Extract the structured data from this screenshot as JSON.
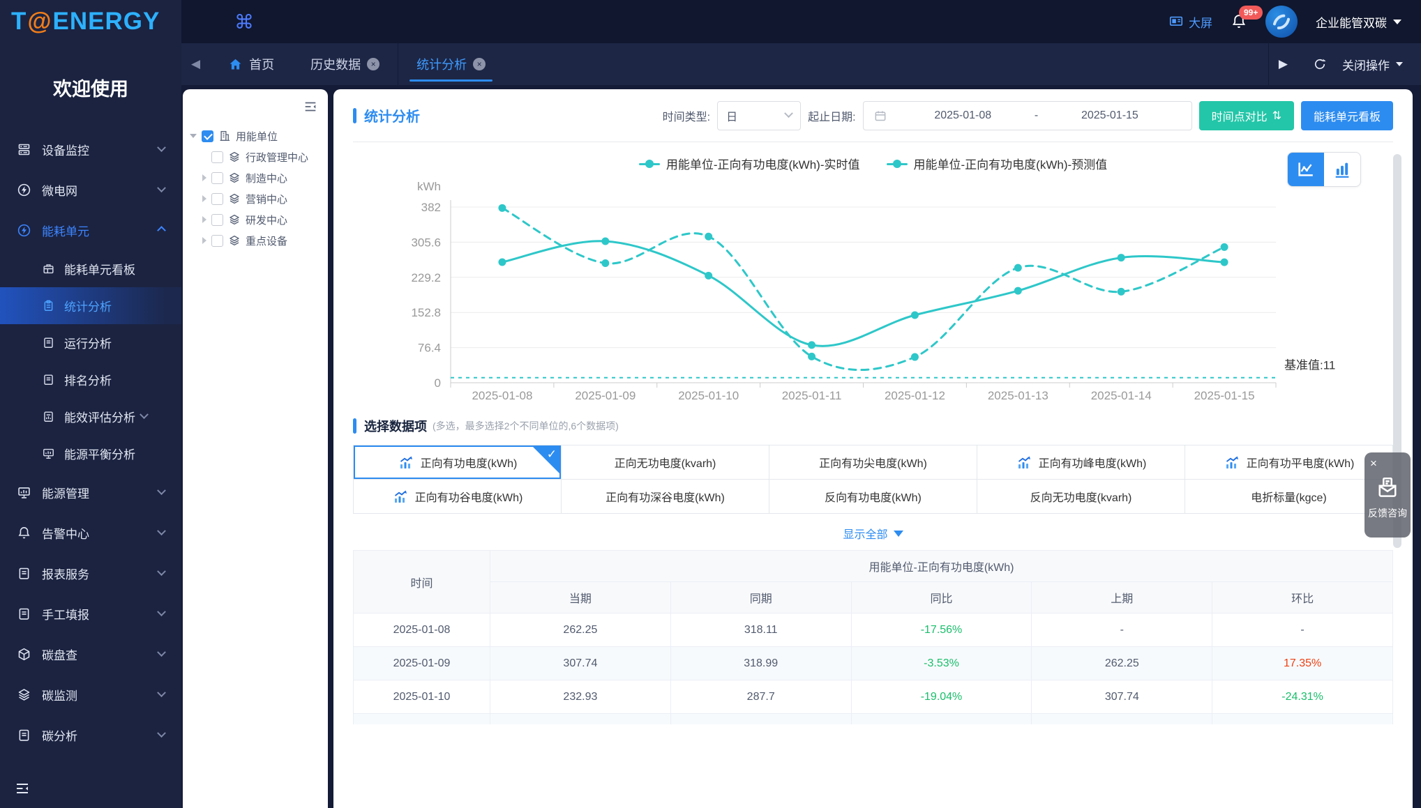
{
  "brand": {
    "logo_t": "T",
    "logo_at": "@",
    "logo_rest": "ENERGY",
    "welcome": "欢迎使用"
  },
  "header": {
    "apps_icon": "⌘",
    "big_screen": "大屏",
    "badge": "99+",
    "org": "企业能管双碳"
  },
  "tabbar": {
    "back_icon": "◀",
    "forward_icon": "▶",
    "home_label": "首页",
    "tabs": [
      {
        "key": "history-data",
        "label": "历史数据",
        "active": false
      },
      {
        "key": "statistical-analysis",
        "label": "统计分析",
        "active": true
      }
    ],
    "close_ops": "关闭操作"
  },
  "sidebar": {
    "items": [
      {
        "key": "device-monitor",
        "label": "设备监控",
        "icon": "server",
        "chevron": "down"
      },
      {
        "key": "microgrid",
        "label": "微电网",
        "icon": "bolt",
        "chevron": "down"
      },
      {
        "key": "energy-unit",
        "label": "能耗单元",
        "icon": "bolt",
        "chevron": "up",
        "active": true,
        "children": [
          {
            "key": "energy-unit-kanban",
            "label": "能耗单元看板",
            "icon": "kanban"
          },
          {
            "key": "statistical-analysis",
            "label": "统计分析",
            "icon": "clipboard",
            "active": true
          },
          {
            "key": "operation-analysis",
            "label": "运行分析",
            "icon": "book"
          },
          {
            "key": "ranking-analysis",
            "label": "排名分析",
            "icon": "book"
          },
          {
            "key": "efficiency-evaluation",
            "label": "能效评估分析",
            "icon": "bookchart",
            "chevron": "down"
          },
          {
            "key": "energy-balance",
            "label": "能源平衡分析",
            "icon": "monitor"
          }
        ]
      },
      {
        "key": "energy-management",
        "label": "能源管理",
        "icon": "monitor",
        "chevron": "down"
      },
      {
        "key": "alarm-center",
        "label": "告警中心",
        "icon": "bell",
        "chevron": "down"
      },
      {
        "key": "report-service",
        "label": "报表服务",
        "icon": "book",
        "chevron": "down"
      },
      {
        "key": "manual-report",
        "label": "手工填报",
        "icon": "book",
        "chevron": "down"
      },
      {
        "key": "carbon-audit",
        "label": "碳盘查",
        "icon": "cube",
        "chevron": "down"
      },
      {
        "key": "carbon-monitoring",
        "label": "碳监测",
        "icon": "layers",
        "chevron": "down"
      },
      {
        "key": "carbon-analysis",
        "label": "碳分析",
        "icon": "book",
        "chevron": "down"
      }
    ]
  },
  "tree": {
    "root_label": "用能单位",
    "children": [
      {
        "key": "admin-center",
        "label": "行政管理中心",
        "caret": false
      },
      {
        "key": "manufacturing-center",
        "label": "制造中心",
        "caret": true
      },
      {
        "key": "marketing-center",
        "label": "营销中心",
        "caret": true
      },
      {
        "key": "rd-center",
        "label": "研发中心",
        "caret": true
      },
      {
        "key": "key-equipment",
        "label": "重点设备",
        "caret": true
      }
    ]
  },
  "page": {
    "title": "统计分析"
  },
  "filters": {
    "time_type_label": "时间类型:",
    "time_type_value": "日",
    "date_label": "起止日期:",
    "date_start": "2025-01-08",
    "date_separator": "-",
    "date_end": "2025-01-15",
    "compare_button": "时间点对比",
    "sort_icon": "⇅",
    "kanban_button": "能耗单元看板"
  },
  "chart_data": {
    "type": "line",
    "ylabel": "kWh",
    "x": [
      "2025-01-08",
      "2025-01-09",
      "2025-01-10",
      "2025-01-11",
      "2025-01-12",
      "2025-01-13",
      "2025-01-14",
      "2025-01-15"
    ],
    "series": [
      {
        "name": "用能单位-正向有功电度(kWh)-实时值",
        "line_style": "solid",
        "values": [
          262.25,
          307.74,
          232.93,
          82,
          147,
          200,
          272,
          262
        ]
      },
      {
        "name": "用能单位-正向有功电度(kWh)-预测值",
        "line_style": "dashed",
        "values": [
          380,
          260,
          318,
          57,
          56,
          250,
          198,
          295
        ]
      }
    ],
    "baseline": {
      "label": "基准值:11",
      "value": 11
    },
    "yticks": [
      0,
      76.4,
      152.8,
      229.2,
      305.6,
      382
    ],
    "ylim": [
      0,
      382
    ],
    "color": "#2ec7c9",
    "legend_position": "top",
    "grid": true
  },
  "selector": {
    "title": "选择数据项",
    "note": "(多选，最多选择2个不同单位的,6个数据项)",
    "show_all": "显示全部",
    "items": [
      {
        "key": "fwd-active",
        "label": "正向有功电度(kWh)",
        "icon": true,
        "selected": true
      },
      {
        "key": "fwd-reactive",
        "label": "正向无功电度(kvarh)",
        "icon": false,
        "selected": false
      },
      {
        "key": "fwd-active-sharp",
        "label": "正向有功尖电度(kWh)",
        "icon": false,
        "selected": false
      },
      {
        "key": "fwd-active-peak",
        "label": "正向有功峰电度(kWh)",
        "icon": true,
        "selected": false
      },
      {
        "key": "fwd-active-flat",
        "label": "正向有功平电度(kWh)",
        "icon": true,
        "selected": false
      },
      {
        "key": "fwd-active-valley",
        "label": "正向有功谷电度(kWh)",
        "icon": true,
        "selected": false
      },
      {
        "key": "fwd-active-deep-valley",
        "label": "正向有功深谷电度(kWh)",
        "icon": false,
        "selected": false
      },
      {
        "key": "rev-active",
        "label": "反向有功电度(kWh)",
        "icon": false,
        "selected": false
      },
      {
        "key": "rev-reactive",
        "label": "反向无功电度(kvarh)",
        "icon": false,
        "selected": false
      },
      {
        "key": "coal-equivalent",
        "label": "电折标量(kgce)",
        "icon": false,
        "selected": false
      }
    ]
  },
  "table": {
    "time_header": "时间",
    "group_header": "用能单位-正向有功电度(kWh)",
    "sub_headers": [
      "当期",
      "同期",
      "同比",
      "上期",
      "环比"
    ],
    "rows": [
      [
        "2025-01-08",
        "262.25",
        "318.11",
        {
          "text": "-17.56%",
          "tone": "green"
        },
        "-",
        "-"
      ],
      [
        "2025-01-09",
        "307.74",
        "318.99",
        {
          "text": "-3.53%",
          "tone": "green"
        },
        "262.25",
        {
          "text": "17.35%",
          "tone": "red"
        }
      ],
      [
        "2025-01-10",
        "232.93",
        "287.7",
        {
          "text": "-19.04%",
          "tone": "green"
        },
        "307.74",
        {
          "text": "-24.31%",
          "tone": "green"
        }
      ],
      [
        "",
        "",
        "",
        "",
        "",
        ""
      ]
    ]
  },
  "feedback": {
    "close": "×",
    "label": "反馈咨询"
  },
  "colors": {
    "accent": "#2d8cf0",
    "teal": "#2ec7c9",
    "teal_button": "#23c6a8",
    "green": "#19be6b",
    "red": "#ed4014"
  }
}
